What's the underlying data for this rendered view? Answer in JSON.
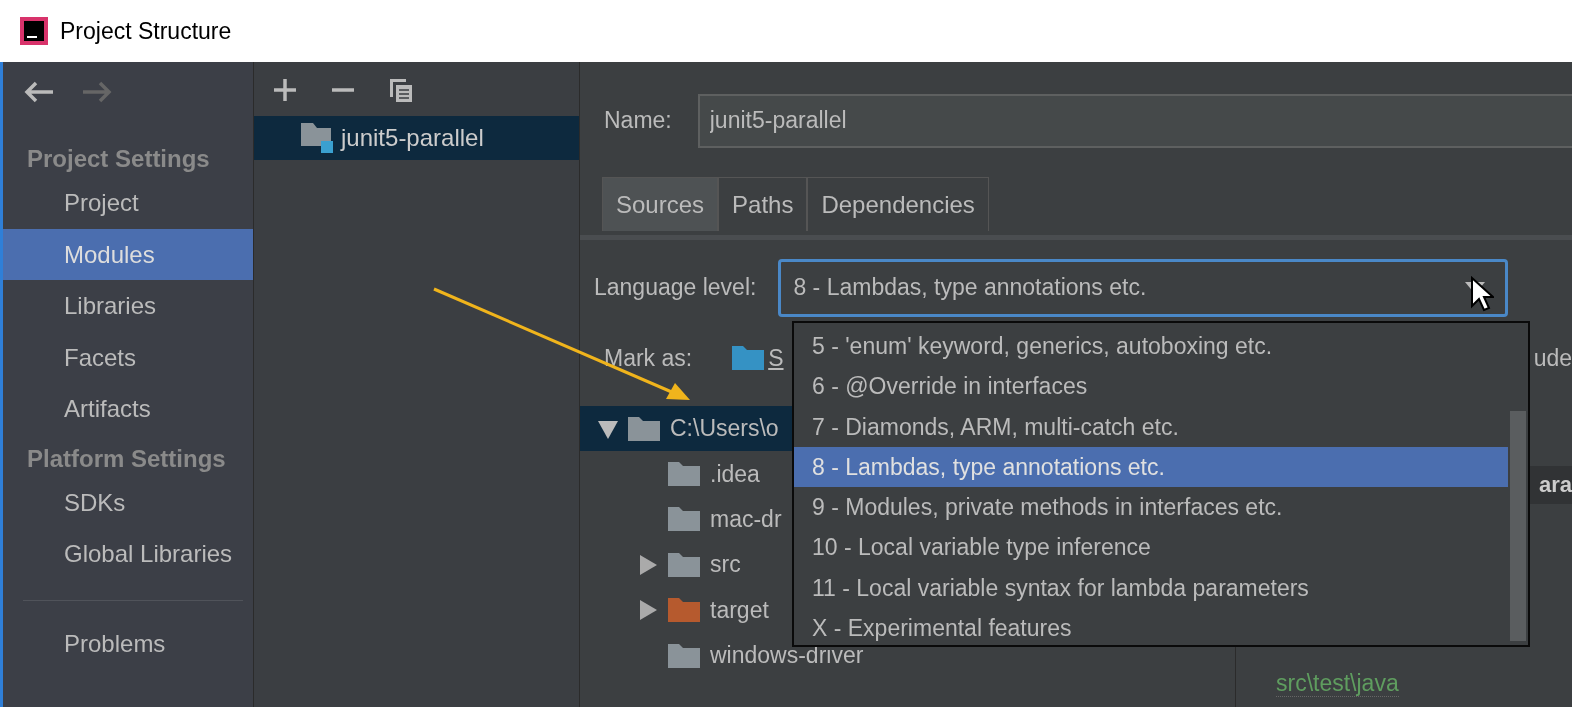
{
  "window": {
    "title": "Project Structure"
  },
  "sidebar": {
    "sections": [
      {
        "heading": "Project Settings",
        "items": [
          {
            "label": "Project",
            "selected": false
          },
          {
            "label": "Modules",
            "selected": true
          },
          {
            "label": "Libraries",
            "selected": false
          },
          {
            "label": "Facets",
            "selected": false
          },
          {
            "label": "Artifacts",
            "selected": false
          }
        ]
      },
      {
        "heading": "Platform Settings",
        "items": [
          {
            "label": "SDKs",
            "selected": false
          },
          {
            "label": "Global Libraries",
            "selected": false
          }
        ]
      }
    ],
    "footer_items": [
      {
        "label": "Problems",
        "selected": false
      }
    ]
  },
  "module_list": {
    "items": [
      {
        "label": "junit5-parallel",
        "selected": true
      }
    ]
  },
  "name_field": {
    "label": "Name:",
    "value": "junit5-parallel"
  },
  "tabs": [
    {
      "label": "Sources",
      "selected": true
    },
    {
      "label": "Paths",
      "selected": false
    },
    {
      "label": "Dependencies",
      "selected": false
    }
  ],
  "language_level": {
    "label": "Language level:",
    "value": "8 - Lambdas, type annotations etc."
  },
  "dropdown": {
    "options": [
      {
        "label": "5 - 'enum' keyword, generics, autoboxing etc.",
        "selected": false
      },
      {
        "label": "6 - @Override in interfaces",
        "selected": false
      },
      {
        "label": "7 - Diamonds, ARM, multi-catch etc.",
        "selected": false
      },
      {
        "label": "8 - Lambdas, type annotations etc.",
        "selected": true
      },
      {
        "label": "9 - Modules, private methods in interfaces etc.",
        "selected": false
      },
      {
        "label": "10 - Local variable type inference",
        "selected": false
      },
      {
        "label": "11 - Local variable syntax for lambda parameters",
        "selected": false
      },
      {
        "label": "X - Experimental features",
        "selected": false
      }
    ]
  },
  "mark_as": {
    "label": "Mark as:",
    "buttons": [
      {
        "label": "S",
        "kind": "sources"
      },
      {
        "label": "ude",
        "kind": "excluded"
      }
    ]
  },
  "tree": {
    "items": [
      {
        "label": "C:\\Users\\o",
        "kind": "folder",
        "expanded": true,
        "selected": true,
        "children": [
          {
            "label": ".idea",
            "kind": "folder",
            "selected": false
          },
          {
            "label": "mac-dr",
            "kind": "folder",
            "selected": false
          },
          {
            "label": "src",
            "kind": "folder",
            "expanded": false,
            "selected": false
          },
          {
            "label": "target",
            "kind": "excluded",
            "expanded": false,
            "selected": false
          },
          {
            "label": "windows-driver",
            "kind": "folder",
            "selected": false
          }
        ]
      }
    ]
  },
  "content_roots": {
    "heading": "ara",
    "folder_path": "src\\test\\java"
  }
}
